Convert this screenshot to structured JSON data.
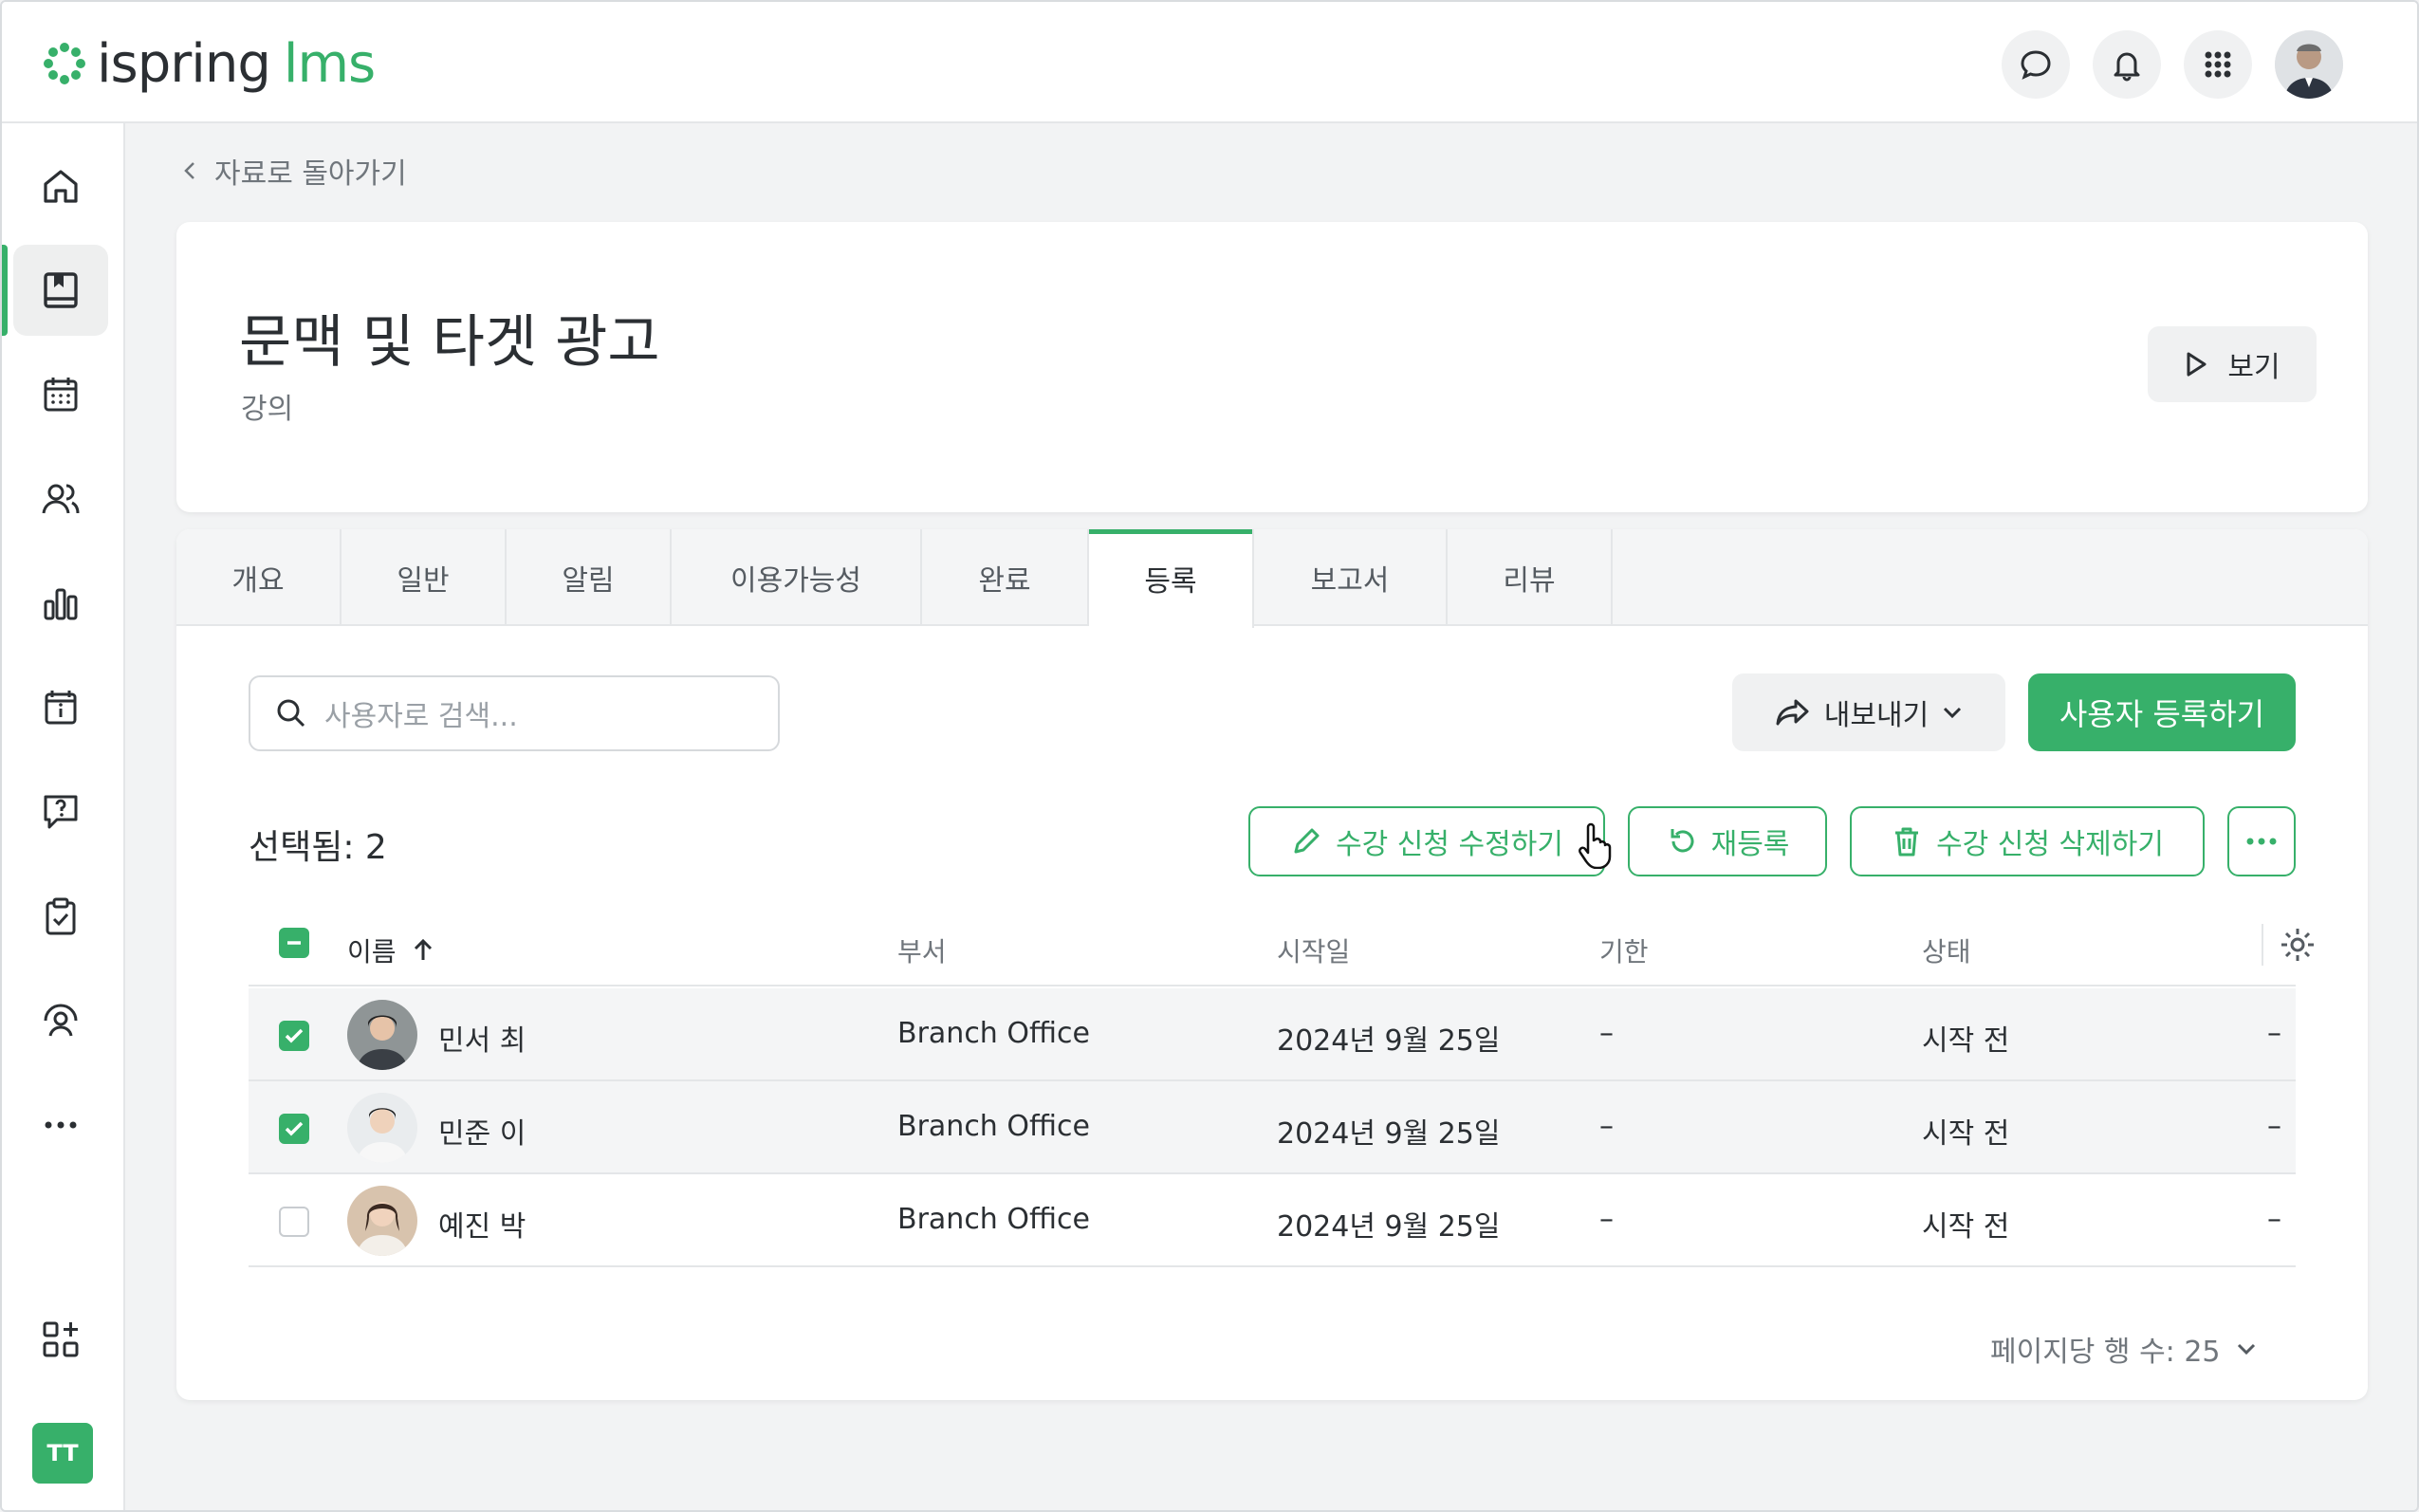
{
  "app": {
    "logo_text_1": "ispring",
    "logo_text_2": "lms",
    "brand_color": "#37b06a"
  },
  "topbar": {
    "icons": [
      "chat-icon",
      "bell-icon",
      "apps-grid-icon",
      "user-avatar"
    ]
  },
  "sidebar": {
    "items": [
      "home-icon",
      "courses-icon",
      "calendar-icon",
      "users-icon",
      "reports-icon",
      "info-board-icon",
      "qa-icon",
      "tasks-icon",
      "coaching-icon",
      "more-icon",
      "add-widget-icon"
    ],
    "active_index": 1,
    "user_badge": "TT"
  },
  "back_link": "자료로 돌아가기",
  "course": {
    "title": "문맥 및 타겟 광고",
    "type": "강의",
    "view_label": "보기"
  },
  "tabs": [
    {
      "label": "개요"
    },
    {
      "label": "일반"
    },
    {
      "label": "알림"
    },
    {
      "label": "이용가능성"
    },
    {
      "label": "완료"
    },
    {
      "label": "등록",
      "active": true
    },
    {
      "label": "보고서"
    },
    {
      "label": "리뷰"
    }
  ],
  "toolbar": {
    "search_placeholder": "사용자로 검색...",
    "export_label": "내보내기",
    "register_label": "사용자 등록하기"
  },
  "selection": {
    "label": "선택됨: 2",
    "edit_label": "수강 신청 수정하기",
    "reenroll_label": "재등록",
    "delete_label": "수강 신청 삭제하기"
  },
  "table": {
    "headers": {
      "name": "이름",
      "department": "부서",
      "start": "시작일",
      "due": "기한",
      "status": "상태"
    },
    "rows": [
      {
        "name": "민서 최",
        "department": "Branch Office",
        "start": "2024년 9월 25일",
        "due": "–",
        "status": "시작 전",
        "extra": "–",
        "checked": true
      },
      {
        "name": "민준 이",
        "department": "Branch Office",
        "start": "2024년 9월 25일",
        "due": "–",
        "status": "시작 전",
        "extra": "–",
        "checked": true
      },
      {
        "name": "예진 박",
        "department": "Branch Office",
        "start": "2024년 9월 25일",
        "due": "–",
        "status": "시작 전",
        "extra": "–",
        "checked": false
      }
    ]
  },
  "pager": {
    "rows_per_page": "페이지당 행 수: 25"
  }
}
